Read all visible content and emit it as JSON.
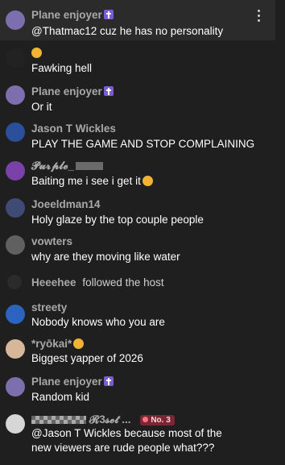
{
  "chat": {
    "messages": [
      {
        "user": "Plane enjoyer",
        "text": "@Thatmac12 cuz he has no personality",
        "badge": "cross-badge",
        "avatar_color": "#7d6fae"
      },
      {
        "user": "",
        "text": "Fawking hell",
        "avatar_color": "#222222"
      },
      {
        "user": "Plane enjoyer",
        "text": "Or it",
        "badge": "cross-badge",
        "avatar_color": "#7d6fae"
      },
      {
        "user": "Jason T Wickles",
        "text": "PLAY THE GAME AND STOP COMPLAINING",
        "avatar_color": "#2b4f9a"
      },
      {
        "user": "𝓟𝓾𝓻𝓹𝓵𝓮_",
        "text": "Baiting me i see i get it",
        "avatar_color": "#7a41a8"
      },
      {
        "user": "Joeeldman14",
        "text": "Holy glaze by the top couple people",
        "avatar_color": "#3f4b74"
      },
      {
        "user": "vowters",
        "text": "why are they moving like water",
        "avatar_color": "#606060"
      },
      {
        "user": "Heeehee",
        "text": "followed the host",
        "type": "system"
      },
      {
        "user": "streety",
        "text": "Nobody knows who you are",
        "avatar_color": "#2d63c0"
      },
      {
        "user": "*ryōkai*",
        "text": "Biggest yapper of 2026",
        "avatar_color": "#d7b79a"
      },
      {
        "user": "Plane enjoyer",
        "text": "Random kid",
        "badge": "cross-badge",
        "avatar_color": "#7d6fae"
      },
      {
        "user": "𝓡3𝓼𝓮𝓽",
        "text_line1": "@Jason T Wickles because most of the",
        "text_line2": "new viewers are rude people what???",
        "rank": "No. 3",
        "avatar_color": "#d6d6d6"
      }
    ]
  }
}
